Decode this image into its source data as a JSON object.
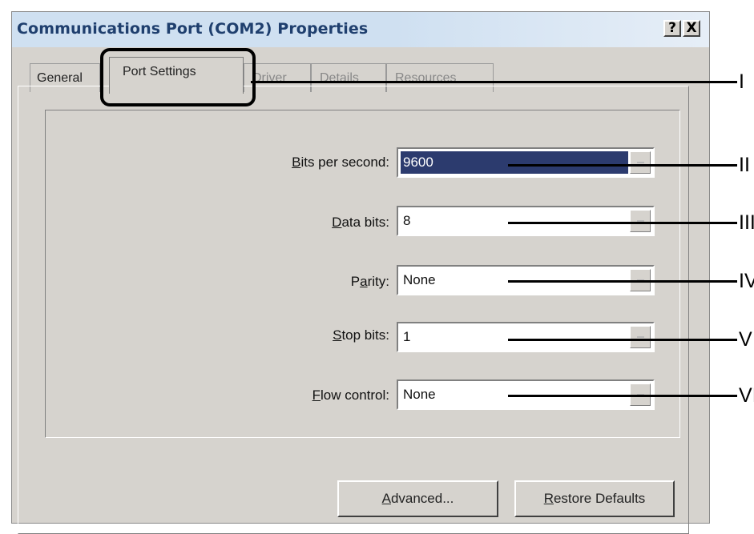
{
  "window": {
    "title": "Communications Port (COM2) Properties",
    "help_label": "?",
    "close_label": "X"
  },
  "tabs": [
    {
      "label": "General"
    },
    {
      "label": "Port Settings"
    },
    {
      "label": "Driver"
    },
    {
      "label": "Details"
    },
    {
      "label": "Resources"
    }
  ],
  "settings": {
    "bits_per_second": {
      "label_mnemonic": "B",
      "label_rest": "its per second:",
      "value": "9600"
    },
    "data_bits": {
      "label_mnemonic": "D",
      "label_rest": "ata bits:",
      "value": "8"
    },
    "parity": {
      "label_pre": "P",
      "label_mnemonic": "a",
      "label_rest": "rity:",
      "value": "None"
    },
    "stop_bits": {
      "label_mnemonic": "S",
      "label_rest": "top bits:",
      "value": "1"
    },
    "flow_control": {
      "label_mnemonic": "F",
      "label_rest": "low control:",
      "value": "None"
    }
  },
  "buttons": {
    "advanced": {
      "mnemonic": "A",
      "rest": "dvanced..."
    },
    "restore": {
      "mnemonic": "R",
      "rest": "estore Defaults"
    }
  },
  "callouts": [
    "I",
    "II",
    "III",
    "IV",
    "V",
    "VI"
  ]
}
